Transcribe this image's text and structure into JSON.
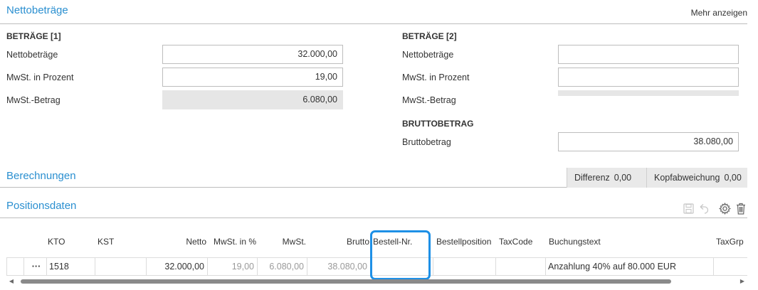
{
  "nettobetraege": {
    "title": "Nettobeträge",
    "more_link": "Mehr anzeigen",
    "group1": {
      "title": "BETRÄGE [1]",
      "netto_label": "Nettobeträge",
      "netto_value": "32.000,00",
      "mwst_pct_label": "MwSt. in Prozent",
      "mwst_pct_value": "19,00",
      "mwst_betrag_label": "MwSt.-Betrag",
      "mwst_betrag_value": "6.080,00"
    },
    "group2": {
      "title": "BETRÄGE [2]",
      "netto_label": "Nettobeträge",
      "netto_value": "",
      "mwst_pct_label": "MwSt. in Prozent",
      "mwst_pct_value": "",
      "mwst_betrag_label": "MwSt.-Betrag"
    },
    "brutto": {
      "title": "BRUTTOBETRAG",
      "label": "Bruttobetrag",
      "value": "38.080,00"
    }
  },
  "berechnungen": {
    "title": "Berechnungen",
    "differenz_label": "Differenz",
    "differenz_value": "0,00",
    "kopfabweichung_label": "Kopfabweichung",
    "kopfabweichung_value": "0,00"
  },
  "positionsdaten": {
    "title": "Positionsdaten",
    "icons": [
      "save-icon",
      "undo-icon",
      "gear-icon",
      "trash-icon"
    ],
    "columns": {
      "kto": "KTO",
      "kst": "KST",
      "netto": "Netto",
      "mwst_pct": "MwSt. in %",
      "mwst": "MwSt.",
      "brutto": "Brutto",
      "bestell_nr": "Bestell-Nr.",
      "bestellposition": "Bestellposition",
      "taxcode": "TaxCode",
      "buchungstext": "Buchungstext",
      "taxgrp": "TaxGrp"
    },
    "rows": [
      {
        "menu": "···",
        "kto": "1518",
        "kst": "",
        "netto": "32.000,00",
        "mwst_pct": "19,00",
        "mwst": "6.080,00",
        "brutto": "38.080,00",
        "bestell_nr": "",
        "bestellposition": "",
        "taxcode": "",
        "buchungstext": "Anzahlung 40% auf 80.000 EUR",
        "taxgrp": ""
      }
    ]
  },
  "colors": {
    "accent": "#2a8fd0",
    "highlight": "#1e90e6",
    "readonly_bg": "#e6e6e6"
  }
}
